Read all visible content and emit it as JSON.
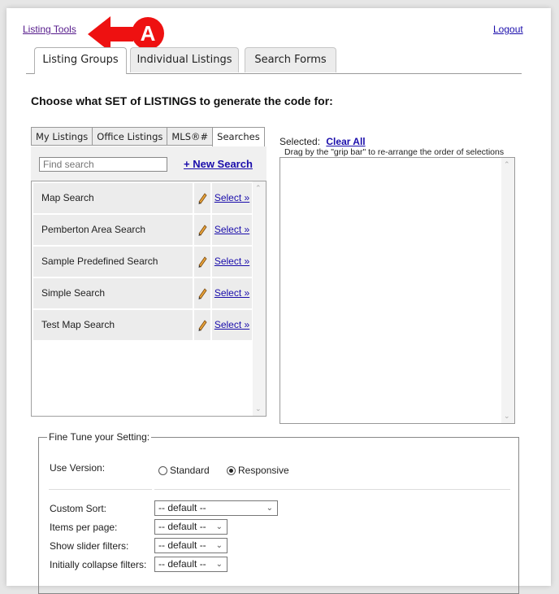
{
  "header": {
    "listing_tools_link": "Listing Tools",
    "logout_link": "Logout",
    "annotation_label": "A",
    "annotation_color": "#ee1111"
  },
  "tabs": [
    {
      "label": "Listing Groups",
      "active": true
    },
    {
      "label": "Individual Listings",
      "active": false
    },
    {
      "label": "Search Forms",
      "active": false
    }
  ],
  "heading": "Choose what SET of LISTINGS to generate the code for:",
  "subtabs": [
    {
      "label": "My Listings"
    },
    {
      "label": "Office Listings"
    },
    {
      "label": "MLS®#"
    },
    {
      "label": "Searches",
      "active": true
    }
  ],
  "search_panel": {
    "find_placeholder": "Find search",
    "new_search_label": "+ New Search",
    "items": [
      {
        "name": "Map Search",
        "select_label": "Select »"
      },
      {
        "name": "Pemberton Area Search",
        "select_label": "Select »"
      },
      {
        "name": "Sample Predefined Search",
        "select_label": "Select »"
      },
      {
        "name": "Simple Search",
        "select_label": "Select »"
      },
      {
        "name": "Test Map Search",
        "select_label": "Select »"
      }
    ]
  },
  "selected_panel": {
    "label": "Selected:",
    "clear_all": "Clear All",
    "hint": "Drag by the \"grip bar\" to re-arrange the order of selections"
  },
  "fine_tune": {
    "legend": "Fine Tune your Setting:",
    "use_version_label": "Use Version:",
    "version_options": [
      {
        "label": "Standard",
        "checked": false
      },
      {
        "label": "Responsive",
        "checked": true
      }
    ],
    "settings": [
      {
        "label": "Custom Sort:",
        "value": "-- default --"
      },
      {
        "label": "Items per page:",
        "value": "-- default --"
      },
      {
        "label": "Show slider filters:",
        "value": "-- default --"
      },
      {
        "label": "Initially collapse filters:",
        "value": "-- default --"
      }
    ]
  }
}
